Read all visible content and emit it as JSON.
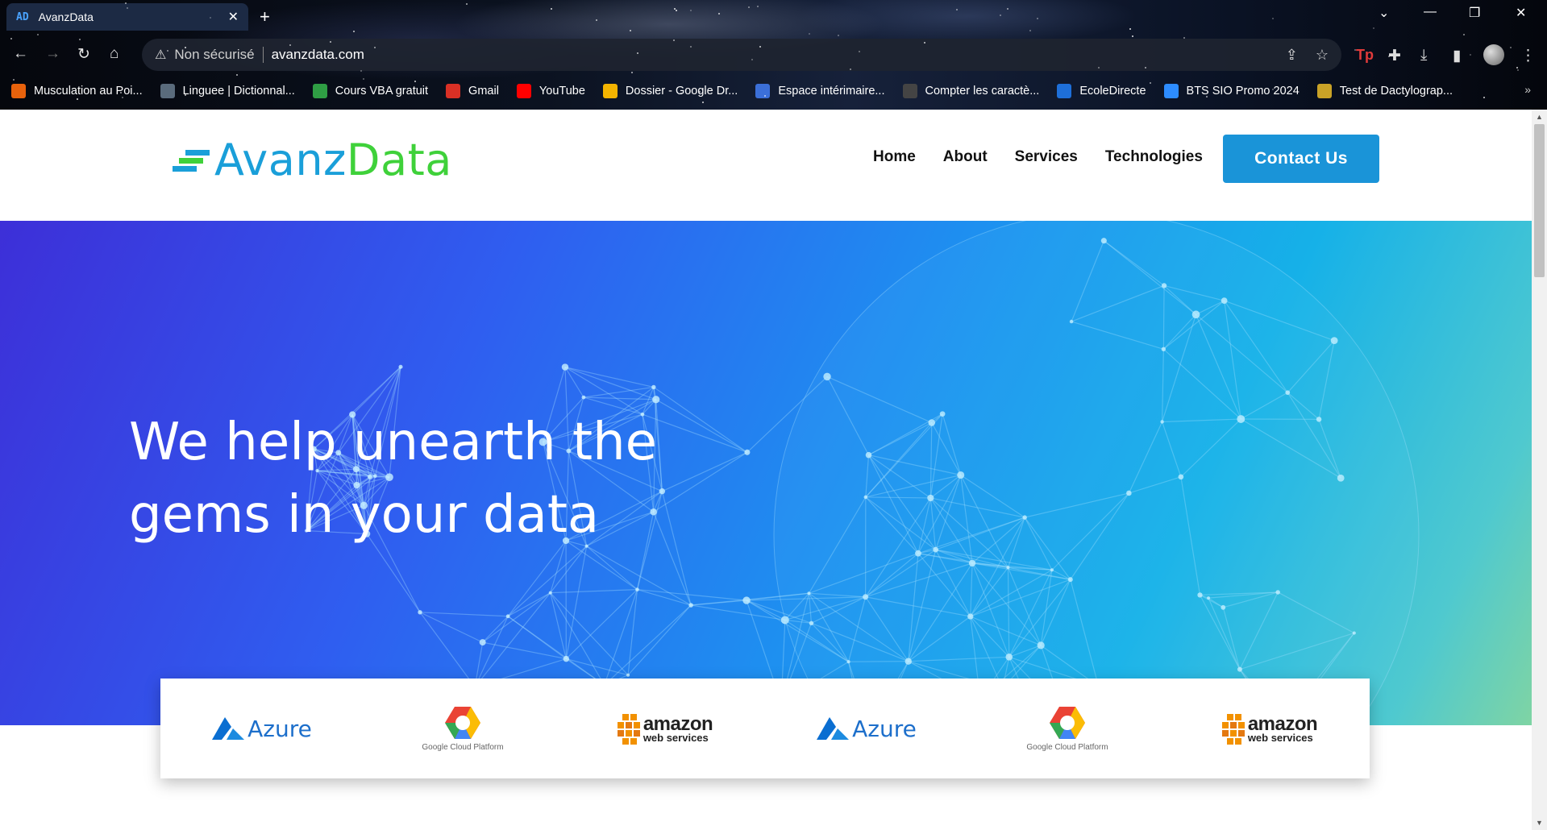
{
  "browser": {
    "tab_title": "AvanzData",
    "tab_favicon": "AD",
    "not_secure": "Non sécurisé",
    "url": "avanzdata.com",
    "bookmarks": [
      {
        "label": "Musculation au Poi...",
        "icon": "muscle-icon",
        "color": "#e8620c"
      },
      {
        "label": "Linguee | Dictionnal...",
        "icon": "linguee-icon",
        "color": "#5a6b7c"
      },
      {
        "label": "Cours VBA gratuit",
        "icon": "vba-icon",
        "color": "#2f9e44"
      },
      {
        "label": "Gmail",
        "icon": "gmail-icon",
        "color": "#d93025"
      },
      {
        "label": "YouTube",
        "icon": "youtube-icon",
        "color": "#ff0000"
      },
      {
        "label": "Dossier - Google Dr...",
        "icon": "drive-icon",
        "color": "#f4b400"
      },
      {
        "label": "Espace intérimaire...",
        "icon": "page-icon",
        "color": "#3b6fd8"
      },
      {
        "label": "Compter les caractè...",
        "icon": "c-icon",
        "color": "#444"
      },
      {
        "label": "EcoleDirecte",
        "icon": "ecole-icon",
        "color": "#1e6fd9"
      },
      {
        "label": "BTS SIO Promo 2024",
        "icon": "bts-icon",
        "color": "#2d8cff"
      },
      {
        "label": "Test de Dactylograp...",
        "icon": "typing-icon",
        "color": "#c9a227"
      }
    ]
  },
  "site": {
    "logo_part1": "Avanz",
    "logo_part2": "Data",
    "nav": [
      "Home",
      "About",
      "Services",
      "Technologies"
    ],
    "contact_label": "Contact Us",
    "hero_title": "We help unearth the gems in your data",
    "partners": [
      {
        "type": "azure",
        "label": "Azure"
      },
      {
        "type": "gcp",
        "label": "Google Cloud Platform"
      },
      {
        "type": "aws",
        "label_big": "amazon",
        "label_small": "web services"
      },
      {
        "type": "azure",
        "label": "Azure"
      },
      {
        "type": "gcp",
        "label": "Google Cloud Platform"
      },
      {
        "type": "aws",
        "label_big": "amazon",
        "label_small": "web services"
      }
    ]
  },
  "colors": {
    "brand_blue": "#1a9fd9",
    "brand_green": "#3fd13a",
    "button_blue": "#1a94d8"
  }
}
